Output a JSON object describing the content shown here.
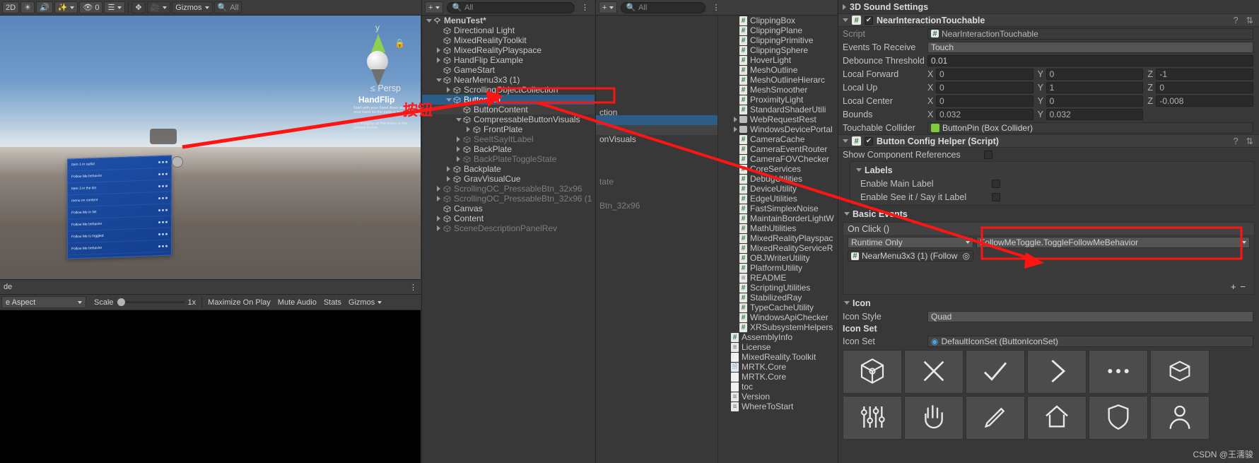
{
  "topbar": {
    "items": [
      "2D",
      "light-icon",
      "audio-icon",
      "fx-icon",
      "0",
      "layers-icon",
      "All",
      "gizmos-caret",
      "hand-icon",
      "camera-icon"
    ],
    "btn_2d": "2D",
    "count": "0",
    "all_label": "All",
    "gizmos_label": "Gizmos"
  },
  "scene": {
    "axis_label": "y",
    "persp_label": "Persp",
    "persp_arrow": "≤",
    "handflip_title": "HandFlip",
    "handflip_line1": "Start with your hand down and flip your hand so the palm is facing up.",
    "handflip_line2": "Try bringing up the menu in the sample below.",
    "menu_rows": [
      "Item 1 in radial",
      "Follow Me behavior",
      "Item 3 in the list",
      "menu on content",
      "Follow Me in list",
      "Follow Me behavior",
      "Follow Me is toggled",
      "Follow Me behavior"
    ]
  },
  "gamebar": {
    "display_label": "de",
    "aspect_label": "e Aspect",
    "scale_label": "Scale",
    "scale_value": "1x",
    "maximize": "Maximize On Play",
    "mute": "Mute Audio",
    "stats": "Stats",
    "gizmos": "Gizmos"
  },
  "hierarchy": {
    "search_placeholder": "All",
    "create_label": "+",
    "items": [
      {
        "label": "MenuTest*",
        "indent": 0,
        "arrow": "down",
        "icon": "scene-icon",
        "state": "normal",
        "bold": true
      },
      {
        "label": "Directional Light",
        "indent": 1,
        "arrow": "none",
        "icon": "gameobject-icon",
        "state": "normal"
      },
      {
        "label": "MixedRealityToolkit",
        "indent": 1,
        "arrow": "none",
        "icon": "gameobject-icon",
        "state": "normal"
      },
      {
        "label": "MixedRealityPlayspace",
        "indent": 1,
        "arrow": "right",
        "icon": "gameobject-icon",
        "state": "normal"
      },
      {
        "label": "HandFlip Example",
        "indent": 1,
        "arrow": "right",
        "icon": "gameobject-icon",
        "state": "normal"
      },
      {
        "label": "GameStart",
        "indent": 1,
        "arrow": "none",
        "icon": "gameobject-icon",
        "state": "normal"
      },
      {
        "label": "NearMenu3x3 (1)",
        "indent": 1,
        "arrow": "down",
        "icon": "gameobject-icon",
        "state": "normal"
      },
      {
        "label": "ScrollingObjectCollection",
        "indent": 2,
        "arrow": "right",
        "icon": "gameobject-icon",
        "state": "normal"
      },
      {
        "label": "ButtonPin",
        "indent": 2,
        "arrow": "down",
        "icon": "gameobject-icon",
        "state": "selected"
      },
      {
        "label": "ButtonContent",
        "indent": 3,
        "arrow": "none",
        "icon": "gameobject-icon",
        "state": "hover"
      },
      {
        "label": "CompressableButtonVisuals",
        "indent": 3,
        "arrow": "down",
        "icon": "gameobject-icon",
        "state": "normal"
      },
      {
        "label": "FrontPlate",
        "indent": 4,
        "arrow": "right",
        "icon": "gameobject-icon",
        "state": "normal"
      },
      {
        "label": "SeeItSayItLabel",
        "indent": 3,
        "arrow": "right",
        "icon": "gameobject-icon",
        "state": "dim"
      },
      {
        "label": "BackPlate",
        "indent": 3,
        "arrow": "right",
        "icon": "gameobject-icon",
        "state": "normal"
      },
      {
        "label": "BackPlateToggleState",
        "indent": 3,
        "arrow": "right",
        "icon": "gameobject-icon",
        "state": "dim"
      },
      {
        "label": "Backplate",
        "indent": 2,
        "arrow": "right",
        "icon": "gameobject-icon",
        "state": "normal"
      },
      {
        "label": "GravVisualCue",
        "indent": 2,
        "arrow": "right",
        "icon": "gameobject-icon",
        "state": "normal"
      },
      {
        "label": "ScrollingOC_PressableBtn_32x96",
        "indent": 1,
        "arrow": "right",
        "icon": "gameobject-icon",
        "state": "dim"
      },
      {
        "label": "ScrollingOC_PressableBtn_32x96 (1",
        "indent": 1,
        "arrow": "right",
        "icon": "gameobject-icon",
        "state": "dim"
      },
      {
        "label": "Canvas",
        "indent": 1,
        "arrow": "none",
        "icon": "gameobject-icon",
        "state": "normal"
      },
      {
        "label": "Content",
        "indent": 1,
        "arrow": "right",
        "icon": "gameobject-icon",
        "state": "normal"
      },
      {
        "label": "SceneDescriptionPanelRev",
        "indent": 1,
        "arrow": "right",
        "icon": "gameobject-icon",
        "state": "dim"
      }
    ]
  },
  "project": {
    "search_placeholder": "All",
    "left_items": [
      {
        "label": "ction",
        "kind": "folder",
        "state": "normal"
      },
      {
        "label": "",
        "kind": "selected-blank",
        "state": "selected"
      },
      {
        "label": "",
        "kind": "blank",
        "state": "hover"
      },
      {
        "label": "onVisuals",
        "kind": "folder",
        "state": "normal"
      },
      {
        "label": "",
        "kind": "blank",
        "state": "normal"
      },
      {
        "label": "",
        "kind": "blank",
        "state": "normal"
      },
      {
        "label": "tate",
        "kind": "folder",
        "state": "dim"
      },
      {
        "label": "Btn_32x96",
        "kind": "folder",
        "state": "dim"
      }
    ],
    "items": [
      {
        "label": "ClippingBox",
        "icon": "cs",
        "arrow": "none"
      },
      {
        "label": "ClippingPlane",
        "icon": "cs",
        "arrow": "none"
      },
      {
        "label": "ClippingPrimitive",
        "icon": "cs",
        "arrow": "none"
      },
      {
        "label": "ClippingSphere",
        "icon": "cs",
        "arrow": "none"
      },
      {
        "label": "HoverLight",
        "icon": "cs",
        "arrow": "none"
      },
      {
        "label": "MeshOutline",
        "icon": "cs",
        "arrow": "none"
      },
      {
        "label": "MeshOutlineHierarc",
        "icon": "cs",
        "arrow": "none"
      },
      {
        "label": "MeshSmoother",
        "icon": "cs",
        "arrow": "none"
      },
      {
        "label": "ProximityLight",
        "icon": "cs",
        "arrow": "none"
      },
      {
        "label": "StandardShaderUtili",
        "icon": "cs",
        "arrow": "none"
      },
      {
        "label": "WebRequestRest",
        "icon": "folder",
        "arrow": "right"
      },
      {
        "label": "WindowsDevicePortal",
        "icon": "folder",
        "arrow": "right"
      },
      {
        "label": "CameraCache",
        "icon": "cs",
        "arrow": "none"
      },
      {
        "label": "CameraEventRouter",
        "icon": "cs",
        "arrow": "none"
      },
      {
        "label": "CameraFOVChecker",
        "icon": "cs",
        "arrow": "none"
      },
      {
        "label": "CoreServices",
        "icon": "cs",
        "arrow": "none"
      },
      {
        "label": "DebugUtilities",
        "icon": "cs",
        "arrow": "none"
      },
      {
        "label": "DeviceUtility",
        "icon": "cs",
        "arrow": "none"
      },
      {
        "label": "EdgeUtilities",
        "icon": "cs",
        "arrow": "none"
      },
      {
        "label": "FastSimplexNoise",
        "icon": "cs",
        "arrow": "none"
      },
      {
        "label": "MaintainBorderLightW",
        "icon": "cs",
        "arrow": "none"
      },
      {
        "label": "MathUtilities",
        "icon": "cs",
        "arrow": "none"
      },
      {
        "label": "MixedRealityPlayspac",
        "icon": "cs",
        "arrow": "none"
      },
      {
        "label": "MixedRealityServiceR",
        "icon": "cs",
        "arrow": "none"
      },
      {
        "label": "OBJWriterUtility",
        "icon": "cs",
        "arrow": "none"
      },
      {
        "label": "PlatformUtility",
        "icon": "cs",
        "arrow": "none"
      },
      {
        "label": "README",
        "icon": "txt",
        "arrow": "none"
      },
      {
        "label": "ScriptingUtilities",
        "icon": "cs",
        "arrow": "none"
      },
      {
        "label": "StabilizedRay",
        "icon": "cs",
        "arrow": "none"
      },
      {
        "label": "TypeCacheUtility",
        "icon": "cs",
        "arrow": "none"
      },
      {
        "label": "WindowsApiChecker",
        "icon": "cs",
        "arrow": "none"
      },
      {
        "label": "XRSubsystemHelpers",
        "icon": "cs",
        "arrow": "none"
      },
      {
        "label": "AssemblyInfo",
        "icon": "cs",
        "arrow": "none",
        "outdent": true
      },
      {
        "label": "License",
        "icon": "txt",
        "arrow": "none",
        "outdent": true
      },
      {
        "label": "MixedReality.Toolkit",
        "icon": "doc",
        "arrow": "none",
        "outdent": true
      },
      {
        "label": "MRTK.Core",
        "icon": "dll",
        "arrow": "none",
        "outdent": true
      },
      {
        "label": "MRTK.Core",
        "icon": "doc",
        "arrow": "none",
        "outdent": true
      },
      {
        "label": "toc",
        "icon": "doc",
        "arrow": "none",
        "outdent": true
      },
      {
        "label": "Version",
        "icon": "txt",
        "arrow": "none",
        "outdent": true
      },
      {
        "label": "WhereToStart",
        "icon": "txt",
        "arrow": "none",
        "outdent": true
      }
    ]
  },
  "inspector": {
    "sound_settings": "3D Sound Settings",
    "component1": {
      "title": "NearInteractionTouchable",
      "rows": [
        {
          "label": "Script",
          "type": "objref",
          "value": "NearInteractionTouchable",
          "dim": true
        },
        {
          "label": "Events To Receive",
          "type": "popup",
          "value": "Touch"
        },
        {
          "label": "Debounce Threshold",
          "type": "text",
          "value": "0.01"
        },
        {
          "label": "Local Forward",
          "type": "vec3",
          "x": "0",
          "y": "0",
          "z": "-1"
        },
        {
          "label": "Local Up",
          "type": "vec3",
          "x": "0",
          "y": "1",
          "z": "0"
        },
        {
          "label": "Local Center",
          "type": "vec3",
          "x": "0",
          "y": "0",
          "z": "-0.008"
        },
        {
          "label": "Bounds",
          "type": "vec2",
          "x": "0.032",
          "y": "0.032"
        },
        {
          "label": "Touchable Collider",
          "type": "objref-green",
          "value": "ButtonPin (Box Collider)"
        }
      ]
    },
    "component2": {
      "title": "Button Config Helper (Script)",
      "show_component_references": "Show Component References",
      "labels_header": "Labels",
      "enable_main_label": "Enable Main Label",
      "enable_see_it_say_it": "Enable See it / Say it Label",
      "basic_events_header": "Basic Events",
      "on_click_header": "On Click ()",
      "runtime_only": "Runtime Only",
      "function_value": "FollowMeToggle.ToggleFollowMeBehavior",
      "object_value": "NearMenu3x3 (1) (Follow",
      "plus": "+",
      "minus": "−",
      "icon_header": "Icon",
      "icon_style_label": "Icon Style",
      "icon_style_value": "Quad",
      "icon_set_header": "Icon Set",
      "icon_set_label": "Icon Set",
      "icon_set_value": "DefaultIconSet (ButtonIconSet)",
      "icon_grid": [
        "cube-icon",
        "close-icon",
        "check-icon",
        "chevron-right-icon",
        "ellipsis-icon",
        "box-open-icon",
        "sliders-icon",
        "hand-icon",
        "pencil-icon",
        "home-icon",
        "shield-icon",
        "person-icon"
      ]
    }
  },
  "annotation": {
    "chinese_label": "按钮",
    "highlight_color": "#ff1414"
  },
  "watermark": "CSDN @王濡骏"
}
